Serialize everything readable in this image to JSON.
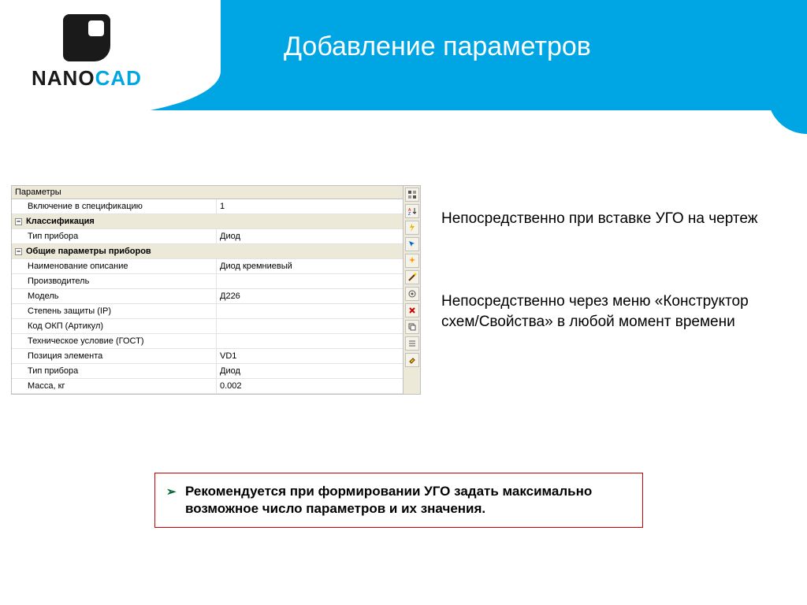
{
  "logo": {
    "brand1": "NANO",
    "brand2": "CAD"
  },
  "slide": {
    "title": "Добавление параметров"
  },
  "panel": {
    "title": "Параметры",
    "rows": [
      {
        "type": "item",
        "label": "Включение в спецификацию",
        "value": "1"
      },
      {
        "type": "group",
        "label": "Классификация"
      },
      {
        "type": "item",
        "label": "Тип прибора",
        "value": "Диод"
      },
      {
        "type": "group",
        "label": "Общие параметры приборов"
      },
      {
        "type": "item",
        "label": "Наименование описание",
        "value": "Диод кремниевый"
      },
      {
        "type": "item",
        "label": "Производитель",
        "value": ""
      },
      {
        "type": "item",
        "label": "Модель",
        "value": "Д226"
      },
      {
        "type": "item",
        "label": "Степень защиты (IP)",
        "value": ""
      },
      {
        "type": "item",
        "label": "Код ОКП (Артикул)",
        "value": ""
      },
      {
        "type": "item",
        "label": "Техническое условие (ГОСТ)",
        "value": ""
      },
      {
        "type": "item",
        "label": "Позиция элемента",
        "value": "VD1"
      },
      {
        "type": "item",
        "label": "Тип прибора",
        "value": "Диод"
      },
      {
        "type": "item",
        "label": "Масса, кг",
        "value": "0.002"
      }
    ],
    "toggle_glyph": "−"
  },
  "toolbar": {
    "names": [
      "categorize-icon",
      "sort-az-icon",
      "thunder-icon",
      "select-icon",
      "spark-icon",
      "wand-icon",
      "settings-icon",
      "delete-x-icon",
      "copy-icon",
      "list-icon",
      "paint-icon"
    ]
  },
  "side": {
    "text1": "Непосредственно при вставке УГО на чертеж",
    "text2": "Непосредственно через меню «Конструктор схем/Свойства» в любой момент времени"
  },
  "rec": {
    "bullet": "➢",
    "text": "Рекомендуется при формировании УГО задать максимально возможное число параметров и их значения."
  }
}
